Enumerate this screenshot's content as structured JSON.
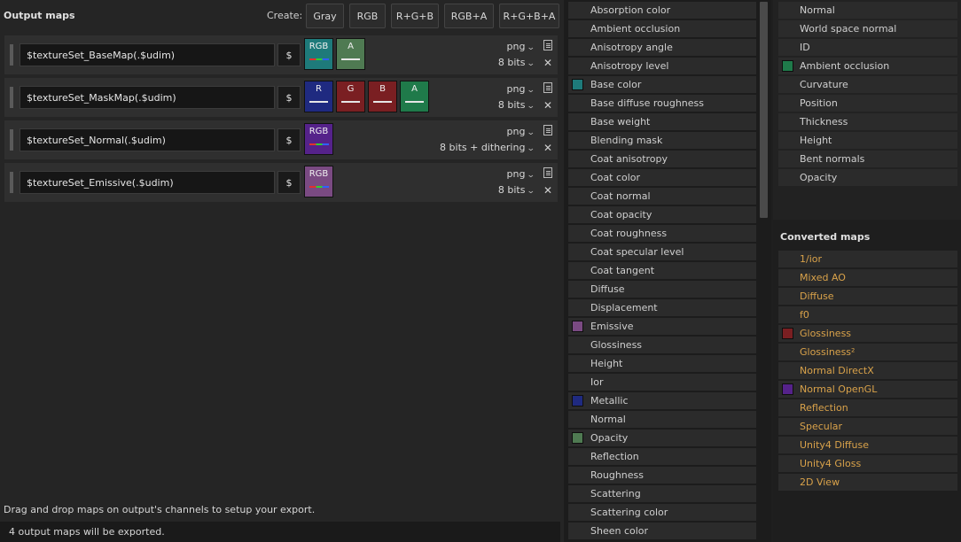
{
  "header": {
    "title": "Output maps",
    "create_label": "Create:",
    "create_buttons": [
      "Gray",
      "RGB",
      "R+G+B",
      "RGB+A",
      "R+G+B+A"
    ]
  },
  "outputs": [
    {
      "name": "$textureSet_BaseMap(.$udim)",
      "channels": [
        {
          "label": "RGB",
          "color": "#1e7a7a"
        },
        {
          "label": "A",
          "color": "#4f7a52"
        }
      ],
      "format": "png",
      "bits": "8 bits"
    },
    {
      "name": "$textureSet_MaskMap(.$udim)",
      "channels": [
        {
          "label": "R",
          "color": "#1f2a80"
        },
        {
          "label": "G",
          "color": "#7a1f22"
        },
        {
          "label": "B",
          "color": "#7a1f22"
        },
        {
          "label": "A",
          "color": "#1f7a4a"
        }
      ],
      "format": "png",
      "bits": "8 bits"
    },
    {
      "name": "$textureSet_Normal(.$udim)",
      "channels": [
        {
          "label": "RGB",
          "color": "#55228a"
        }
      ],
      "format": "png",
      "bits": "8 bits + dithering"
    },
    {
      "name": "$textureSet_Emissive(.$udim)",
      "channels": [
        {
          "label": "RGB",
          "color": "#7a4a82"
        }
      ],
      "format": "png",
      "bits": "8 bits"
    }
  ],
  "dollar_label": "$",
  "hint": "Drag and drop maps on output's channels to setup your export.",
  "status": "4 output maps will be exported.",
  "channels_list": [
    {
      "label": "Absorption color",
      "swatch": ""
    },
    {
      "label": "Ambient occlusion",
      "swatch": ""
    },
    {
      "label": "Anisotropy angle",
      "swatch": ""
    },
    {
      "label": "Anisotropy level",
      "swatch": ""
    },
    {
      "label": "Base color",
      "swatch": "#1e7a7a"
    },
    {
      "label": "Base diffuse roughness",
      "swatch": ""
    },
    {
      "label": "Base weight",
      "swatch": ""
    },
    {
      "label": "Blending mask",
      "swatch": ""
    },
    {
      "label": "Coat anisotropy",
      "swatch": ""
    },
    {
      "label": "Coat color",
      "swatch": ""
    },
    {
      "label": "Coat normal",
      "swatch": ""
    },
    {
      "label": "Coat opacity",
      "swatch": ""
    },
    {
      "label": "Coat roughness",
      "swatch": ""
    },
    {
      "label": "Coat specular level",
      "swatch": ""
    },
    {
      "label": "Coat tangent",
      "swatch": ""
    },
    {
      "label": "Diffuse",
      "swatch": ""
    },
    {
      "label": "Displacement",
      "swatch": ""
    },
    {
      "label": "Emissive",
      "swatch": "#7a4a82"
    },
    {
      "label": "Glossiness",
      "swatch": ""
    },
    {
      "label": "Height",
      "swatch": ""
    },
    {
      "label": "Ior",
      "swatch": ""
    },
    {
      "label": "Metallic",
      "swatch": "#1f2a80"
    },
    {
      "label": "Normal",
      "swatch": ""
    },
    {
      "label": "Opacity",
      "swatch": "#4f7a52"
    },
    {
      "label": "Reflection",
      "swatch": ""
    },
    {
      "label": "Roughness",
      "swatch": ""
    },
    {
      "label": "Scattering",
      "swatch": ""
    },
    {
      "label": "Scattering color",
      "swatch": ""
    },
    {
      "label": "Sheen color",
      "swatch": ""
    }
  ],
  "mesh_maps": [
    {
      "label": "Normal",
      "swatch": ""
    },
    {
      "label": "World space normal",
      "swatch": ""
    },
    {
      "label": "ID",
      "swatch": ""
    },
    {
      "label": "Ambient occlusion",
      "swatch": "#1f7a4a"
    },
    {
      "label": "Curvature",
      "swatch": ""
    },
    {
      "label": "Position",
      "swatch": ""
    },
    {
      "label": "Thickness",
      "swatch": ""
    },
    {
      "label": "Height",
      "swatch": ""
    },
    {
      "label": "Bent normals",
      "swatch": ""
    },
    {
      "label": "Opacity",
      "swatch": ""
    }
  ],
  "converted_title": "Converted maps",
  "converted_maps": [
    {
      "label": "1/ior",
      "swatch": ""
    },
    {
      "label": "Mixed AO",
      "swatch": ""
    },
    {
      "label": "Diffuse",
      "swatch": ""
    },
    {
      "label": "f0",
      "swatch": ""
    },
    {
      "label": "Glossiness",
      "swatch": "#7a1f22"
    },
    {
      "label": "Glossiness²",
      "swatch": ""
    },
    {
      "label": "Normal DirectX",
      "swatch": ""
    },
    {
      "label": "Normal OpenGL",
      "swatch": "#55228a"
    },
    {
      "label": "Reflection",
      "swatch": ""
    },
    {
      "label": "Specular",
      "swatch": ""
    },
    {
      "label": "Unity4 Diffuse",
      "swatch": ""
    },
    {
      "label": "Unity4 Gloss",
      "swatch": ""
    },
    {
      "label": "2D View",
      "swatch": ""
    }
  ]
}
